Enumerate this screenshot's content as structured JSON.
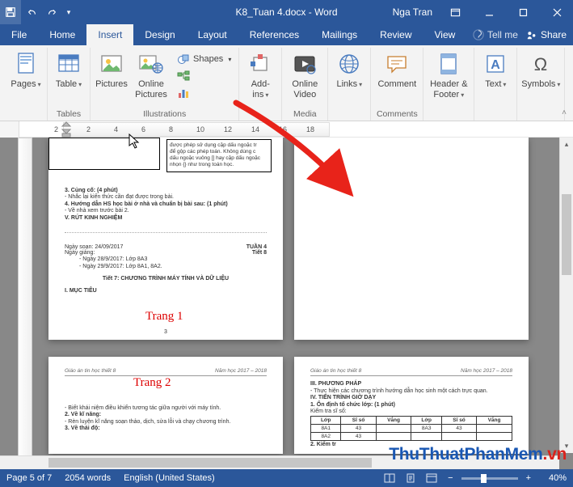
{
  "titlebar": {
    "doc_title": "K8_Tuan 4.docx - Word",
    "user": "Nga Tran"
  },
  "tabs": {
    "file": "File",
    "home": "Home",
    "insert": "Insert",
    "design": "Design",
    "layout": "Layout",
    "references": "References",
    "mailings": "Mailings",
    "review": "Review",
    "view": "View",
    "tellme": "Tell me",
    "share": "Share"
  },
  "ribbon": {
    "pages": {
      "btn": "Pages",
      "group": ""
    },
    "tables": {
      "btn": "Table",
      "group": "Tables"
    },
    "illus": {
      "pictures": "Pictures",
      "online_pictures": "Online Pictures",
      "shapes": "Shapes",
      "smartart": "",
      "chart": "",
      "screenshot": "",
      "group": "Illustrations"
    },
    "addins": {
      "btn": "Add-ins",
      "group": ""
    },
    "media": {
      "btn": "Online Video",
      "group": "Media"
    },
    "links": {
      "btn": "Links",
      "group": ""
    },
    "comments": {
      "btn": "Comment",
      "group": "Comments"
    },
    "hf": {
      "btn": "Header & Footer",
      "group": ""
    },
    "text": {
      "btn": "Text",
      "group": ""
    },
    "symbols": {
      "btn": "Symbols",
      "group": ""
    }
  },
  "ruler": {
    "marks": [
      "2",
      "",
      "2",
      "4",
      "6",
      "8",
      "10",
      "12",
      "14",
      "16",
      "18"
    ]
  },
  "pages": {
    "p1": {
      "box_text": "được phép sử dụng cặp dấu ngoặc tr<br>để gộp các phép toán. Không dùng c<br>dấu ngoặc vuông [] hay cặp dấu ngoặc<br>nhọn {} như trong toán học.",
      "l1": "3. Củng cố: (4 phút)",
      "l2": "- Nhắc lại kiến thức cần đạt được trong bài.",
      "l3": "4. Hướng dẫn HS học bài ở nhà và chuẩn bị bài sau: (1 phút)",
      "l4": "- Về nhà xem trước bài 2.",
      "l5": "V. RÚT KINH NGHIỆM",
      "date": "Ngày soạn: 24/09/2017",
      "tuan": "TUẦN 4",
      "tiet": "Tiết 8",
      "giangA": "- Ngày 28/9/2017: Lớp 8A3",
      "giangB": "- Ngày 29/9/2017: Lớp 8A1, 8A2.",
      "giang_lbl": "Ngày giảng:",
      "title": "Tiết 7: CHƯƠNG TRÌNH MÁY TÍNH VÀ DỮ LIỆU",
      "muc": "I. MỤC TIÊU",
      "label": "Trang 1",
      "foot": "3"
    },
    "p2": {
      "hdr_l": "Giáo án tin học thiết 8",
      "hdr_r": "Năm học 2017 – 2018",
      "label": "Trang 2",
      "l1": "- Biết khái niệm điều khiển tương tác giữa người với máy tính.",
      "l2": "2. Về kĩ năng:",
      "l3": "- Rèn luyện kĩ năng soạn thảo, dịch, sửa lỗi và chạy chương trình.",
      "l4": "3. Về thái độ:"
    },
    "p3": {
      "hdr_l": "Giáo án tin học thiết 8",
      "hdr_r": "Năm học 2017 – 2018",
      "h1": "III. PHƯƠNG PHÁP",
      "l1": "- Thực hiện các chương trình hướng dẫn học sinh một cách trực quan.",
      "h2": "IV. TIẾN TRÌNH GIỜ DẠY",
      "h3": "1. Ổn định tổ chức lớp: (1 phút)",
      "l2": "Kiểm tra sĩ số:",
      "h4": "2. Kiểm tr",
      "table": {
        "headers": [
          "Lớp",
          "Sĩ số",
          "Vắng",
          "Lớp",
          "Sĩ số",
          "Vắng"
        ],
        "rows": [
          [
            "8A1",
            "43",
            "",
            "8A3",
            "43",
            ""
          ],
          [
            "8A2",
            "43",
            "",
            "",
            "",
            ""
          ]
        ]
      }
    }
  },
  "status": {
    "page": "Page 5 of 7",
    "words": "2054 words",
    "lang": "English (United States)",
    "zoom": "40%"
  },
  "watermark": {
    "main": "ThuThuatPhanMem",
    "ext": ".vn"
  }
}
